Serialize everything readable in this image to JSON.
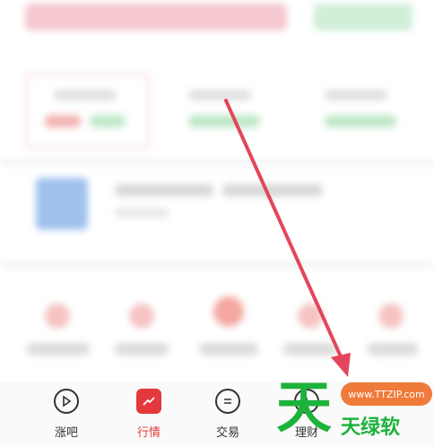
{
  "tabs": [
    {
      "label": "涨吧",
      "icon": "play-circle-icon"
    },
    {
      "label": "行情",
      "icon": "trend-chart-icon"
    },
    {
      "label": "交易",
      "icon": "exchange-icon"
    },
    {
      "label": "理财",
      "icon": "wealth-icon"
    }
  ],
  "watermark": {
    "url": "www.TTZIP.com",
    "char": "天",
    "brand": "天绿软"
  },
  "colors": {
    "accent": "#e4393c",
    "arrow": "#e3465c",
    "watermark_green": "#1db23b",
    "watermark_orange": "#f07a3a"
  }
}
